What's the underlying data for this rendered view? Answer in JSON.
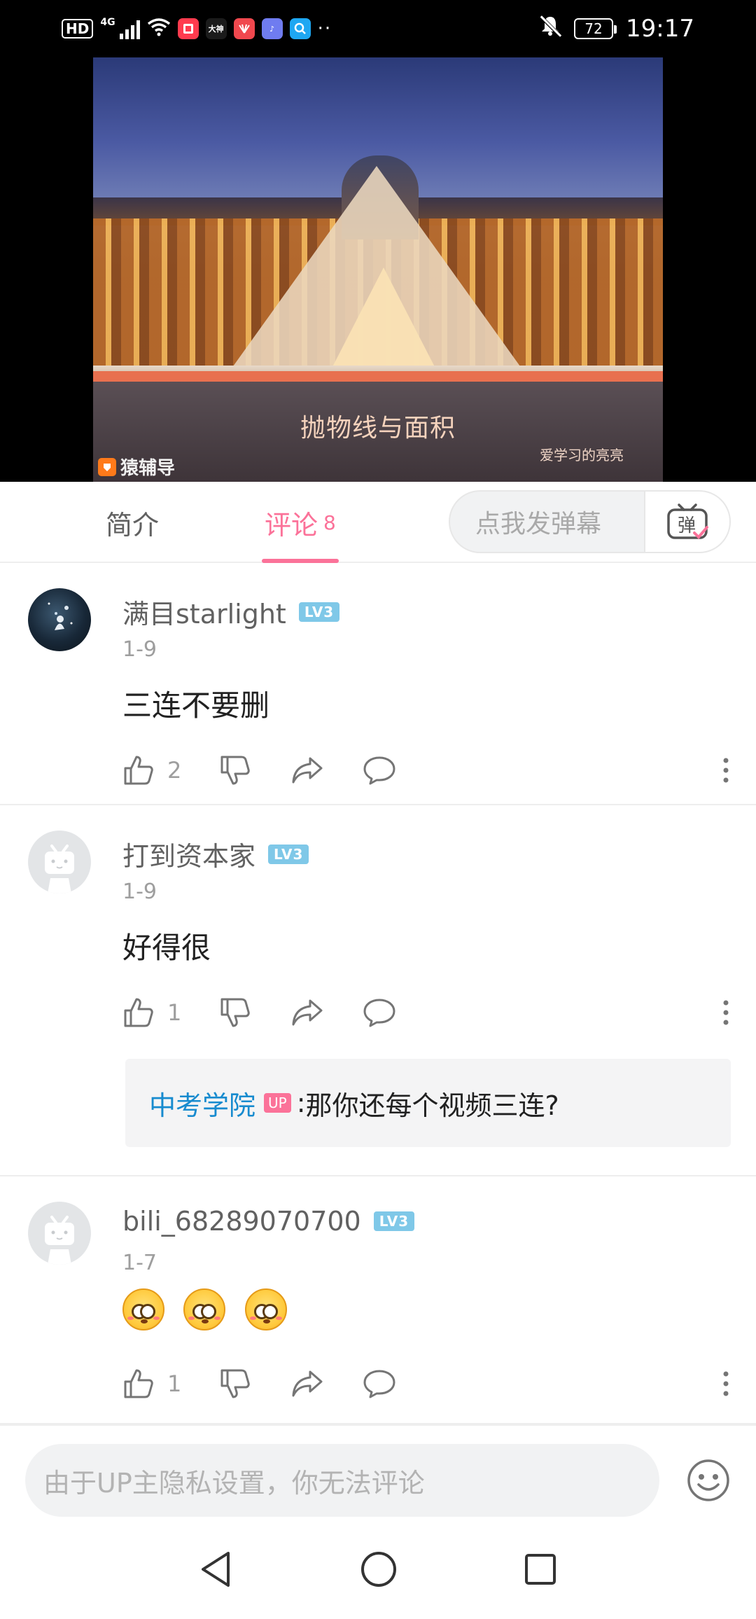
{
  "status_bar": {
    "hd": "HD",
    "network": "4G",
    "time": "19:17",
    "battery": "72",
    "apps": [
      {
        "name": "red-book-app-icon",
        "label": "",
        "color": "#ff3b4e"
      },
      {
        "name": "dashen-app-icon",
        "label": "大神",
        "color": "#1b1b1b"
      },
      {
        "name": "huawei-app-icon",
        "label": "",
        "color": "#f0484e"
      },
      {
        "name": "music-app-icon",
        "label": "♪",
        "color": "#6f7cf0"
      },
      {
        "name": "search-app-icon",
        "label": "⌕",
        "color": "#1ea7f2"
      }
    ],
    "more": "··"
  },
  "video": {
    "title": "抛物线与面积",
    "author": "爱学习的亮亮",
    "logo_text": "猿辅导"
  },
  "tabs": {
    "intro_label": "简介",
    "comments_label": "评论",
    "comments_count": "8",
    "danmaku_placeholder": "点我发弹幕",
    "danmaku_button": "弹"
  },
  "comments": [
    {
      "username": "满目starlight",
      "level": "LV3",
      "date": "1-9",
      "text": "三连不要删",
      "likes": "2"
    },
    {
      "username": "打到资本家",
      "level": "LV3",
      "date": "1-9",
      "text": "好得很",
      "likes": "1",
      "reply": {
        "user": "中考学院",
        "badge": "UP",
        "separator": ":",
        "text": "那你还每个视频三连?"
      }
    },
    {
      "username": "bili_68289070700",
      "level": "LV3",
      "date": "1-7",
      "emoji_count": 3,
      "likes": "1"
    }
  ],
  "comment_input": {
    "placeholder": "由于UP主隐私设置，你无法评论"
  },
  "colors": {
    "accent": "#fb7299",
    "link": "#178bcf",
    "level": "#7fc8e8"
  }
}
